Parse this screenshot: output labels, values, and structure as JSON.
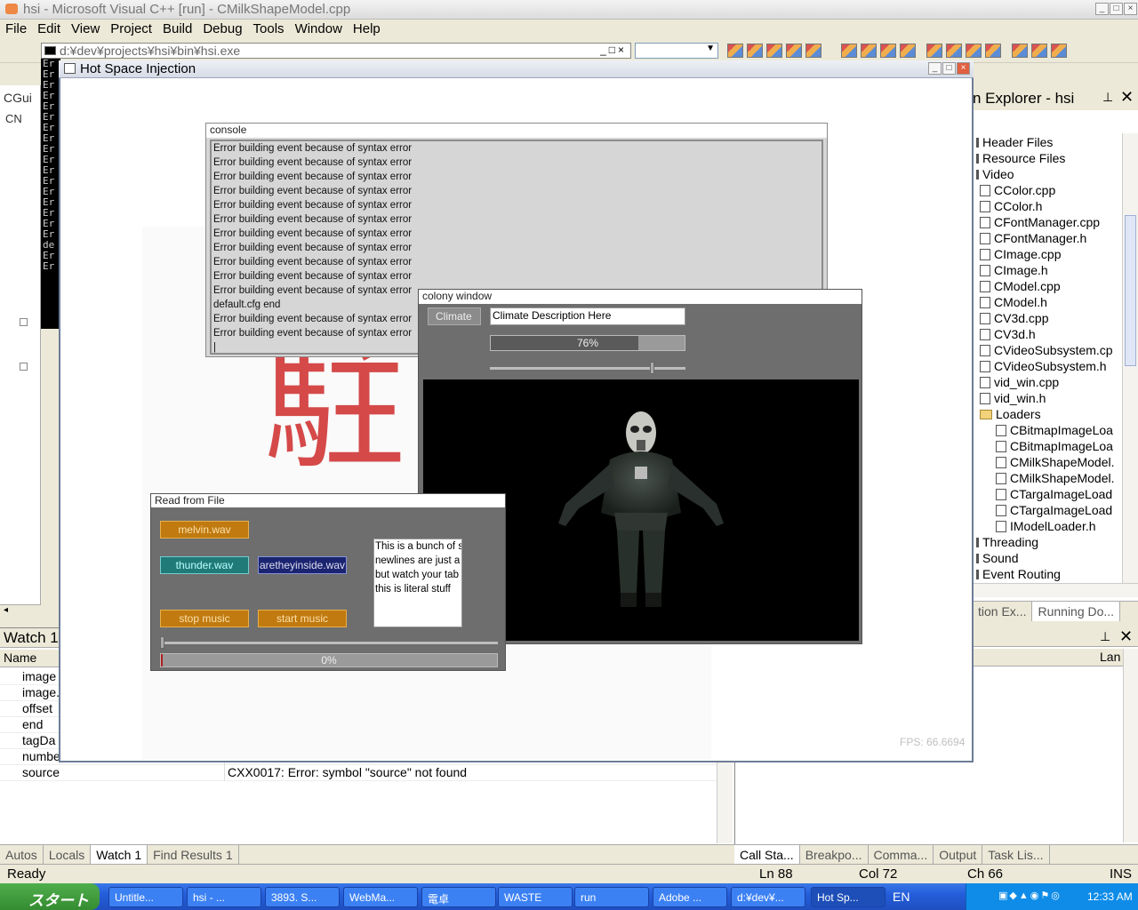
{
  "ide": {
    "title": "hsi - Microsoft Visual C++ [run] - CMilkShapeModel.cpp",
    "menu": [
      "File",
      "Edit",
      "View",
      "Project",
      "Build",
      "Debug",
      "Tools",
      "Window",
      "Help"
    ],
    "console_path": "d:¥dev¥projects¥hsi¥bin¥hsi.exe",
    "left_tab1": "CGui",
    "left_tab2": "CN",
    "cmd_lines": [
      "Er",
      "Er",
      "Er",
      "Er",
      "Er",
      "Er",
      "Er",
      "Er",
      "Er",
      "Er",
      "Er",
      "Er",
      "Er",
      "Er",
      "Er",
      "Er",
      "Er",
      "de",
      "Er",
      "Er"
    ]
  },
  "solution_explorer": {
    "title": "n Explorer - hsi",
    "items": [
      {
        "label": "Header Files",
        "kind": "folder"
      },
      {
        "label": "Resource Files",
        "kind": "folder"
      },
      {
        "label": "Video",
        "kind": "folder"
      },
      {
        "label": "CColor.cpp",
        "kind": "file"
      },
      {
        "label": "CColor.h",
        "kind": "file"
      },
      {
        "label": "CFontManager.cpp",
        "kind": "file"
      },
      {
        "label": "CFontManager.h",
        "kind": "file"
      },
      {
        "label": "CImage.cpp",
        "kind": "file"
      },
      {
        "label": "CImage.h",
        "kind": "file"
      },
      {
        "label": "CModel.cpp",
        "kind": "file"
      },
      {
        "label": "CModel.h",
        "kind": "file"
      },
      {
        "label": "CV3d.cpp",
        "kind": "file"
      },
      {
        "label": "CV3d.h",
        "kind": "file"
      },
      {
        "label": "CVideoSubsystem.cp",
        "kind": "file"
      },
      {
        "label": "CVideoSubsystem.h",
        "kind": "file"
      },
      {
        "label": "vid_win.cpp",
        "kind": "file"
      },
      {
        "label": "vid_win.h",
        "kind": "file"
      },
      {
        "label": "Loaders",
        "kind": "folder-open"
      },
      {
        "label": "CBitmapImageLoa",
        "kind": "file"
      },
      {
        "label": "CBitmapImageLoa",
        "kind": "file"
      },
      {
        "label": "CMilkShapeModel.",
        "kind": "file"
      },
      {
        "label": "CMilkShapeModel.",
        "kind": "file"
      },
      {
        "label": "CTargaImageLoad",
        "kind": "file"
      },
      {
        "label": "CTargaImageLoad",
        "kind": "file"
      },
      {
        "label": "IModelLoader.h",
        "kind": "file"
      },
      {
        "label": "Threading",
        "kind": "folder"
      },
      {
        "label": "Sound",
        "kind": "folder"
      },
      {
        "label": "Event Routing",
        "kind": "folder"
      }
    ],
    "bottom_tabs": [
      "tion Ex...",
      "Running Do..."
    ]
  },
  "watch": {
    "title": "Watch 1",
    "col_name": "Name",
    "rows": [
      {
        "name": "image",
        "value": ""
      },
      {
        "name": "image.",
        "value": ""
      },
      {
        "name": "offset",
        "value": ""
      },
      {
        "name": "end",
        "value": ""
      },
      {
        "name": "tagDa",
        "value": ""
      },
      {
        "name": "numbe",
        "value": ""
      },
      {
        "name": "source",
        "value": "CXX0017: Error: symbol \"source\" not found"
      }
    ],
    "tabs": [
      "Autos",
      "Locals",
      "Watch 1",
      "Find Results 1"
    ]
  },
  "right_bottom": {
    "col": "Lan",
    "tabs": [
      "Call Sta...",
      "Breakpo...",
      "Comma...",
      "Output",
      "Task Lis..."
    ]
  },
  "status": {
    "text": "Ready",
    "ln": "Ln 88",
    "col": "Col 72",
    "ch": "Ch 66",
    "ins": "INS"
  },
  "taskbar": {
    "start": "スタート",
    "tasks": [
      "Untitle...",
      "hsi - ...",
      "3893. S...",
      "WebMa...",
      "電卓",
      "WASTE",
      "run",
      "Adobe ...",
      "d:¥dev¥...",
      "Hot Sp..."
    ],
    "lang": "EN",
    "time": "12:33 AM"
  },
  "app": {
    "title": "Hot Space Injection",
    "fps": "FPS: 66.6694",
    "kanji": "駐"
  },
  "console": {
    "title": "console",
    "lines": [
      "Error building event because of syntax error",
      "Error building event because of syntax error",
      "Error building event because of syntax error",
      "Error building event because of syntax error",
      "Error building event because of syntax error",
      "Error building event because of syntax error",
      "Error building event because of syntax error",
      "Error building event because of syntax error",
      "Error building event because of syntax error",
      "Error building event because of syntax error",
      "Error building event because of syntax error",
      "default.cfg end",
      "Error building event because of syntax error",
      "Error building event because of syntax error",
      "|"
    ]
  },
  "colony": {
    "title": "colony window",
    "tab": "Climate",
    "description": "Climate Description Here",
    "progress": 76,
    "progress_label": "76%",
    "slider_value": 0.82
  },
  "read_from_file": {
    "title": "Read from File",
    "buttons": {
      "melvin": "melvin.wav",
      "thunder": "thunder.wav",
      "aretheyinside": "aretheyinside.wav",
      "stop": "stop music",
      "start": "start music"
    },
    "text_box": [
      "This is a bunch of s",
      "newlines are just a",
      "but watch your tab",
      "this is literal stuff"
    ],
    "slider_value": 0.0,
    "progress": 0,
    "progress_label": "0%"
  },
  "colors": {
    "orange": "#c07a10",
    "teal": "#1f7a78",
    "navy": "#1a2470",
    "panel": "#6e6e6e",
    "progress_fill": "#5a5a5a"
  }
}
